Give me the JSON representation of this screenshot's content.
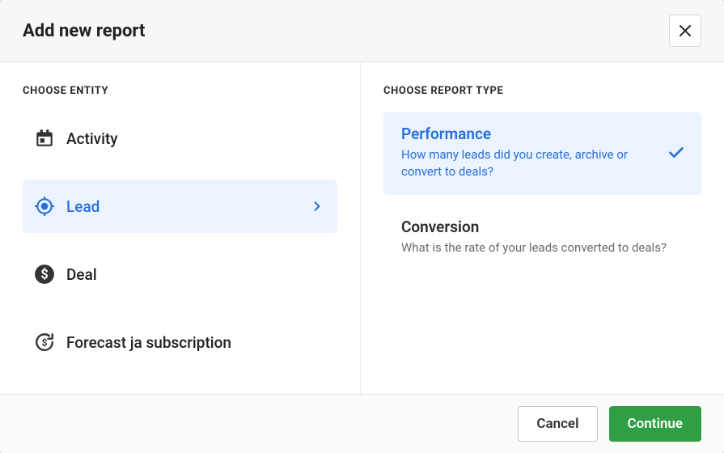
{
  "header": {
    "title": "Add new report"
  },
  "left": {
    "label": "CHOOSE ENTITY",
    "items": [
      {
        "label": "Activity",
        "icon": "calendar-icon",
        "selected": false
      },
      {
        "label": "Lead",
        "icon": "target-icon",
        "selected": true
      },
      {
        "label": "Deal",
        "icon": "dollar-circle-icon",
        "selected": false
      },
      {
        "label": "Forecast ja subscription",
        "icon": "refresh-dollar-icon",
        "selected": false
      }
    ]
  },
  "right": {
    "label": "CHOOSE REPORT TYPE",
    "items": [
      {
        "title": "Performance",
        "desc": "How many leads did you create, archive or convert to deals?",
        "selected": true
      },
      {
        "title": "Conversion",
        "desc": "What is the rate of your leads converted to deals?",
        "selected": false
      }
    ]
  },
  "footer": {
    "cancel": "Cancel",
    "continue": "Continue"
  },
  "colors": {
    "accent": "#2a6fdb",
    "selection_bg": "#eaf3fe",
    "primary_btn": "#2f9e44"
  }
}
